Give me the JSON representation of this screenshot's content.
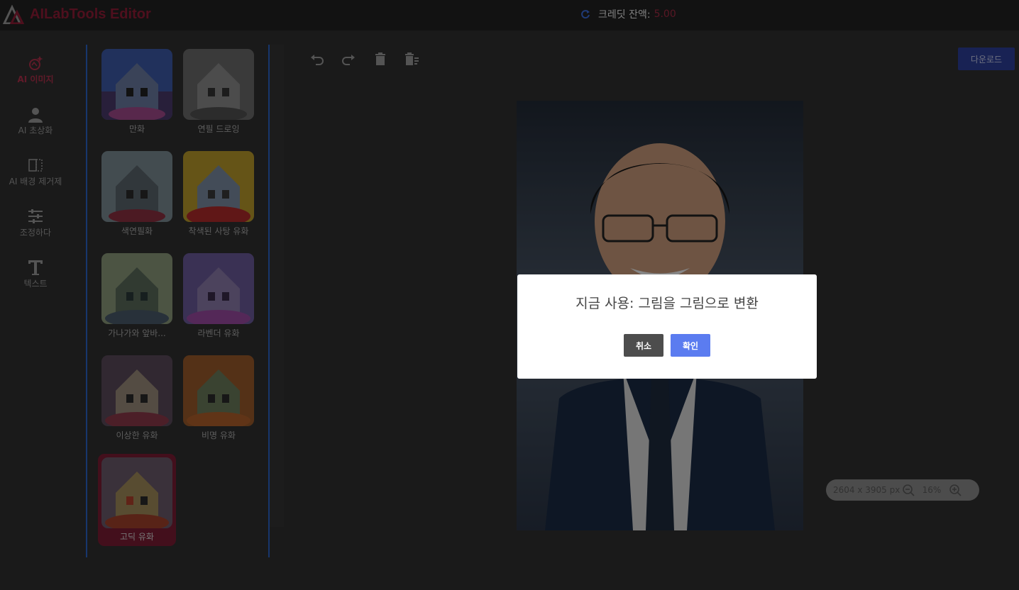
{
  "app": {
    "title": "AILabTools Editor"
  },
  "credit": {
    "label": "크레딧 잔액:",
    "value": "5.00"
  },
  "nav": [
    {
      "label": "AI 이미지",
      "icon": "ai-image-icon",
      "active": true
    },
    {
      "label": "AI 초상화",
      "icon": "person-icon",
      "active": false
    },
    {
      "label": "AI 배경 제거제",
      "icon": "background-remove-icon",
      "active": false
    },
    {
      "label": "조정하다",
      "icon": "sliders-icon",
      "active": false
    },
    {
      "label": "텍스트",
      "icon": "text-icon",
      "active": false
    }
  ],
  "styles": [
    {
      "label": "만화"
    },
    {
      "label": "연필 드로잉"
    },
    {
      "label": "색연필화"
    },
    {
      "label": "착색된 사탕 유화"
    },
    {
      "label": "가나가와 앞바..."
    },
    {
      "label": "라벤더 유화"
    },
    {
      "label": "이상한 유화"
    },
    {
      "label": "비명 유화"
    },
    {
      "label": "고딕 유화"
    }
  ],
  "toolbar": {
    "undo": "undo-icon",
    "redo": "redo-icon",
    "delete": "trash-icon",
    "clear": "clear-all-icon",
    "download_label": "다운로드"
  },
  "zoom": {
    "size_text": "2604 x 3905 px",
    "level": "16%"
  },
  "modal": {
    "title": "지금 사용: 그림을 그림으로 변환",
    "cancel_label": "취소",
    "ok_label": "확인"
  }
}
